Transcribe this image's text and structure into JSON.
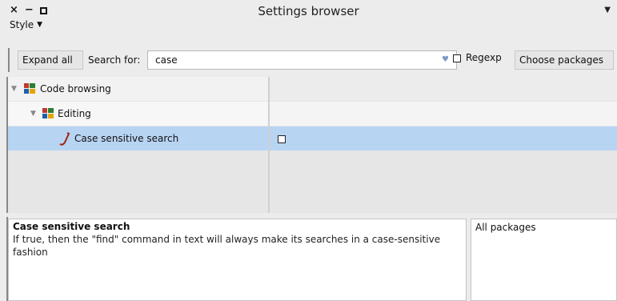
{
  "window": {
    "title": "Settings browser",
    "style_menu": "Style"
  },
  "toolbar": {
    "expand_all": "Expand all",
    "search_label": "Search for:",
    "search_value": "case",
    "regexp_label": "Regexp",
    "choose_packages": "Choose packages"
  },
  "tree": {
    "rows": [
      {
        "label": "Code browsing",
        "level": 0,
        "expanded": true
      },
      {
        "label": "Editing",
        "level": 1,
        "expanded": true
      },
      {
        "label": "Case sensitive search",
        "level": 2,
        "selected": true,
        "value_checked": false
      }
    ]
  },
  "description": {
    "title": "Case sensitive search",
    "text": "If true, then the \"find\" command in text will always make its searches in a case-sensitive fashion"
  },
  "packages": {
    "label": "All packages"
  },
  "colors": {
    "selection": "#b8d4f3",
    "background": "#ececec"
  },
  "icons": {
    "window_close": "close-icon",
    "window_minimize": "minimize-icon",
    "window_maximize": "maximize-icon",
    "package": "package-icon",
    "setting": "setting-icon"
  }
}
